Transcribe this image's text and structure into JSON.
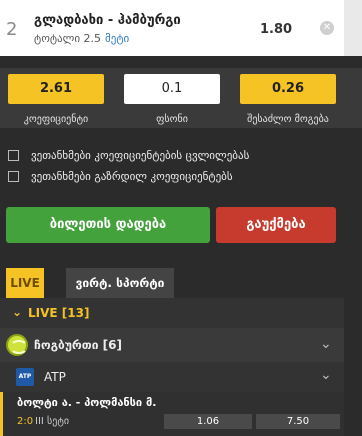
{
  "bet_slip": {
    "index": "2",
    "match": "გლადბახი - ჰამბურგი",
    "market": "ტოტალი 2.5",
    "selection": "მეტი",
    "odd": "1.80",
    "close_icon": "x-icon"
  },
  "stake": {
    "coefficient": "2.61",
    "stake_value": "0.1",
    "possible_win": "0.26",
    "coefficient_label": "კოეფიციენტი",
    "stake_label": "ფსონი",
    "possible_win_label": "შესაძლო მოგება"
  },
  "options": {
    "accept_changed_odds": "ვეთანხმები კოეფიციენტების ცვლილებას",
    "accept_increased_odds": "ვეთანხმები გაზრდილ კოეფიციენტებს"
  },
  "actions": {
    "place_bet": "ბილეთის დადება",
    "cancel": "გაუქმება"
  },
  "tabs": {
    "live": "LIVE",
    "virtual_sport": "ვირტ. სპორტი"
  },
  "list": {
    "live_header": "LIVE [13]",
    "sport": "ჩოგბურთი [6]",
    "league": "ATP",
    "league_logo_text": "ATP",
    "event": {
      "title": "ბოლტი ა. - პოლმანსი მ.",
      "score": "2:0",
      "set": "III სეტი",
      "odds": [
        "1.06",
        "7.50"
      ]
    }
  },
  "colors": {
    "accent_yellow": "#f5c324",
    "place_green": "#43a23b",
    "cancel_red": "#c73b2e"
  }
}
